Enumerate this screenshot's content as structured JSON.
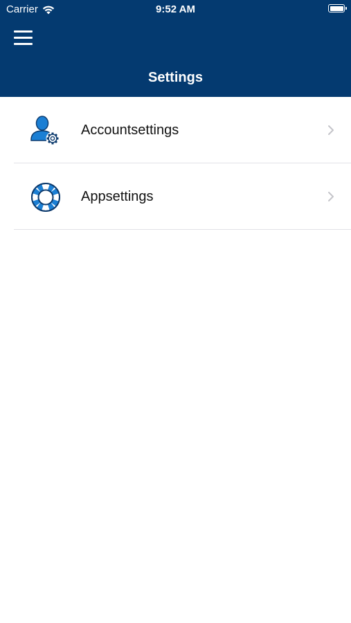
{
  "status_bar": {
    "carrier": "Carrier",
    "time": "9:52 AM"
  },
  "header": {
    "title": "Settings",
    "menu_icon": "hamburger-menu-icon",
    "background_color": "#043a70"
  },
  "settings_list": {
    "items": [
      {
        "label": "Accountsettings",
        "icon": "user-gear-icon",
        "trailing_icon": "chevron-right-icon"
      },
      {
        "label": "Appsettings",
        "icon": "lifebuoy-icon",
        "trailing_icon": "chevron-right-icon"
      }
    ]
  },
  "colors": {
    "accent": "#1b7fd4",
    "icon_dark": "#0d3b6e",
    "chevron": "#c4c4c9",
    "divider": "#e2e2e6"
  }
}
